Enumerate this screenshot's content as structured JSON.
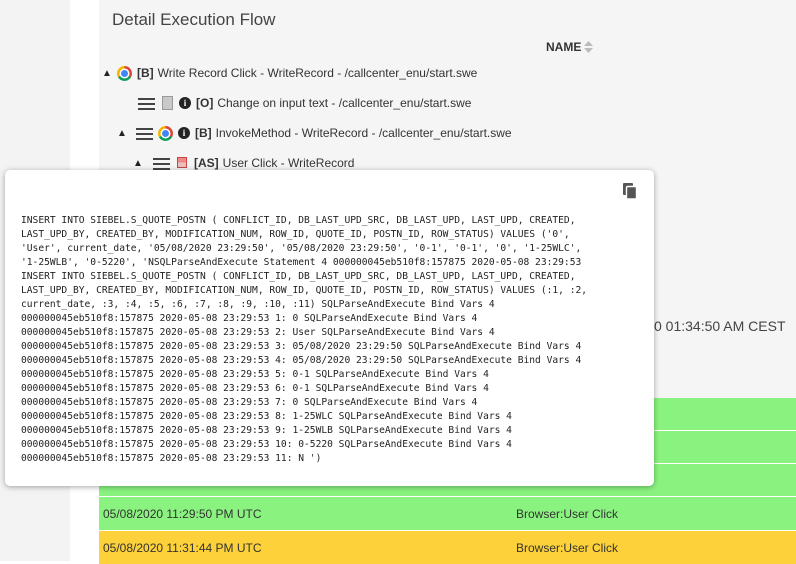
{
  "panel": {
    "title": "Detail Execution Flow",
    "column_header": "NAME",
    "partial_timestamp": "0 01:34:50 AM CEST"
  },
  "tree": [
    {
      "tag": "[B]",
      "text": "Write Record Click - WriteRecord - /callcenter_enu/start.swe",
      "icon": "chrome-icon",
      "expanded": true
    },
    {
      "tag": "[O]",
      "text": "Change on input text - /callcenter_enu/start.swe",
      "icon": "document-icon",
      "expanded": false
    },
    {
      "tag": "[B]",
      "text": "InvokeMethod - WriteRecord - /callcenter_enu/start.swe",
      "icon": "chrome-icon",
      "expanded": true
    },
    {
      "tag": "[AS]",
      "text": "User Click - WriteRecord",
      "icon": "user-click-icon",
      "expanded": true
    }
  ],
  "popup": {
    "sql_text": "INSERT INTO SIEBEL.S_QUOTE_POSTN ( CONFLICT_ID, DB_LAST_UPD_SRC, DB_LAST_UPD, LAST_UPD, CREATED,\nLAST_UPD_BY, CREATED_BY, MODIFICATION_NUM, ROW_ID, QUOTE_ID, POSTN_ID, ROW_STATUS) VALUES ('0',\n'User', current_date, '05/08/2020 23:29:50', '05/08/2020 23:29:50', '0-1', '0-1', '0', '1-25WLC',\n'1-25WLB', '0-5220', 'NSQLParseAndExecute Statement 4 000000045eb510f8:157875 2020-05-08 23:29:53\nINSERT INTO SIEBEL.S_QUOTE_POSTN ( CONFLICT_ID, DB_LAST_UPD_SRC, DB_LAST_UPD, LAST_UPD, CREATED,\nLAST_UPD_BY, CREATED_BY, MODIFICATION_NUM, ROW_ID, QUOTE_ID, POSTN_ID, ROW_STATUS) VALUES (:1, :2,\ncurrent_date, :3, :4, :5, :6, :7, :8, :9, :10, :11) SQLParseAndExecute Bind Vars 4\n000000045eb510f8:157875 2020-05-08 23:29:53 1: 0 SQLParseAndExecute Bind Vars 4\n000000045eb510f8:157875 2020-05-08 23:29:53 2: User SQLParseAndExecute Bind Vars 4\n000000045eb510f8:157875 2020-05-08 23:29:53 3: 05/08/2020 23:29:50 SQLParseAndExecute Bind Vars 4\n000000045eb510f8:157875 2020-05-08 23:29:53 4: 05/08/2020 23:29:50 SQLParseAndExecute Bind Vars 4\n000000045eb510f8:157875 2020-05-08 23:29:53 5: 0-1 SQLParseAndExecute Bind Vars 4\n000000045eb510f8:157875 2020-05-08 23:29:53 6: 0-1 SQLParseAndExecute Bind Vars 4\n000000045eb510f8:157875 2020-05-08 23:29:53 7: 0 SQLParseAndExecute Bind Vars 4\n000000045eb510f8:157875 2020-05-08 23:29:53 8: 1-25WLC SQLParseAndExecute Bind Vars 4\n000000045eb510f8:157875 2020-05-08 23:29:53 9: 1-25WLB SQLParseAndExecute Bind Vars 4\n000000045eb510f8:157875 2020-05-08 23:29:53 10: 0-5220 SQLParseAndExecute Bind Vars 4\n000000045eb510f8:157875 2020-05-08 23:29:53 11: N ')",
    "copy_icon": "copy-icon"
  },
  "rows": [
    {
      "timestamp": "05/08/2020 11:29:50 PM UTC",
      "name": "Browser:User Click",
      "status_color": "#8af37f"
    },
    {
      "timestamp": "05/08/2020 11:31:44 PM UTC",
      "name": "Browser:User Click",
      "status_color": "#fdd13a"
    }
  ],
  "colors": {
    "green_row": "#8af37f",
    "yellow_row": "#fdd13a",
    "panel_bg": "#f5f5f5"
  }
}
